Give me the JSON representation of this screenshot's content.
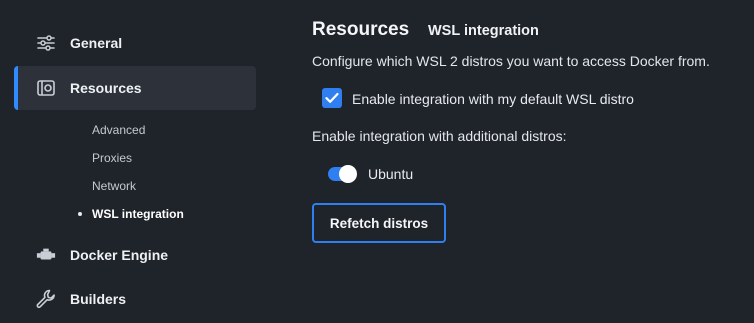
{
  "sidebar": {
    "items": [
      {
        "label": "General",
        "icon": "sliders-icon"
      },
      {
        "label": "Resources",
        "icon": "resources-icon"
      },
      {
        "label": "Docker Engine",
        "icon": "engine-icon"
      },
      {
        "label": "Builders",
        "icon": "wrench-icon"
      }
    ],
    "sub_items": [
      {
        "label": "Advanced"
      },
      {
        "label": "Proxies"
      },
      {
        "label": "Network"
      },
      {
        "label": "WSL integration"
      }
    ]
  },
  "main": {
    "title": "Resources",
    "subtitle": "WSL integration",
    "description": "Configure which WSL 2 distros you want to access Docker from.",
    "default_distro_checkbox": {
      "label": "Enable integration with my default WSL distro",
      "checked": true
    },
    "additional_label": "Enable integration with additional distros:",
    "distros": [
      {
        "name": "Ubuntu",
        "enabled": true
      }
    ],
    "refetch_label": "Refetch distros"
  },
  "colors": {
    "accent": "#2f7ff0",
    "background": "#1f232a",
    "active_item": "#2d323a"
  }
}
